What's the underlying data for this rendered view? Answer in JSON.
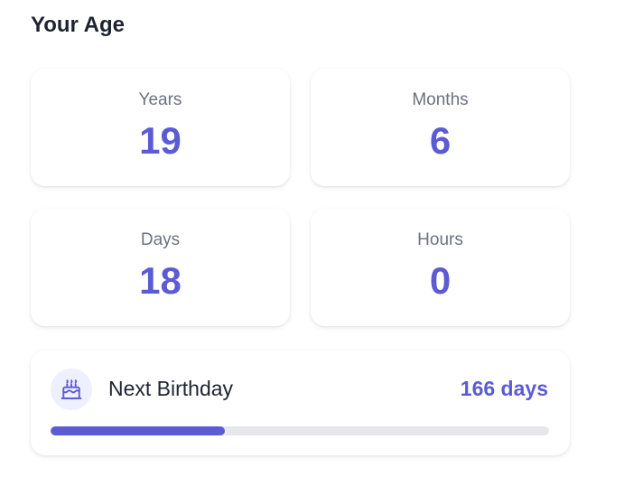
{
  "header": {
    "title": "Your Age"
  },
  "accent": "#5b5bd6",
  "stats": [
    {
      "label": "Years",
      "value": "19"
    },
    {
      "label": "Months",
      "value": "6"
    },
    {
      "label": "Days",
      "value": "18"
    },
    {
      "label": "Hours",
      "value": "0"
    }
  ],
  "next_birthday": {
    "icon": "birthday-cake-icon",
    "label": "Next Birthday",
    "days": "166 days",
    "progress_fraction": 0.35
  }
}
